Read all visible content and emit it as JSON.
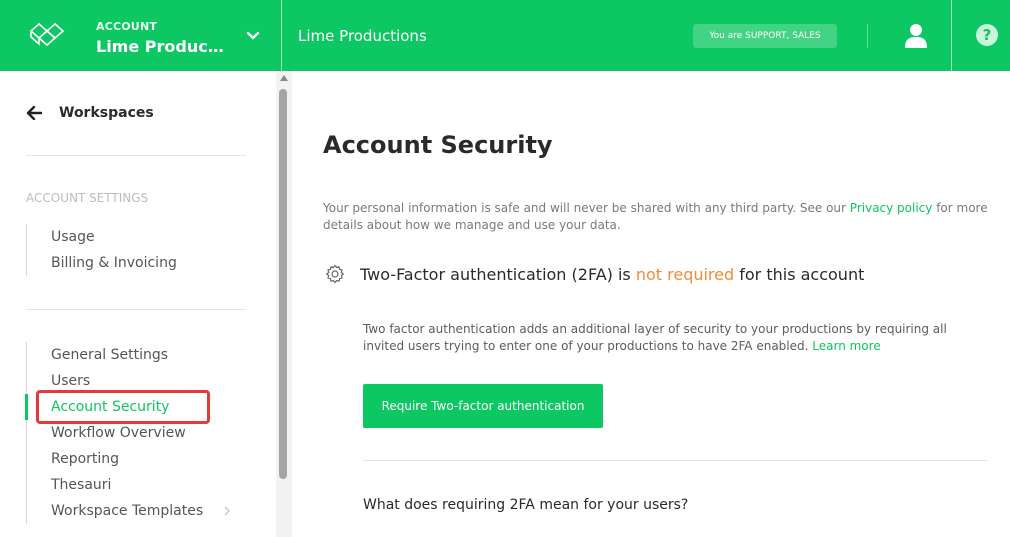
{
  "topbar": {
    "account_label": "ACCOUNT",
    "account_name": "Lime Productions",
    "production_title": "Lime Productions",
    "role_badge": "You are SUPPORT, SALES",
    "help_glyph": "?",
    "brand_color": "#0dc762"
  },
  "sidebar": {
    "back_label": "Workspaces",
    "section_heading": "ACCOUNT SETTINGS",
    "group1": [
      {
        "label": "Usage"
      },
      {
        "label": "Billing & Invoicing"
      }
    ],
    "group2": [
      {
        "label": "General Settings"
      },
      {
        "label": "Users"
      },
      {
        "label": "Account Security",
        "active": true
      },
      {
        "label": "Workflow Overview"
      },
      {
        "label": "Reporting"
      },
      {
        "label": "Thesauri"
      },
      {
        "label": "Workspace Templates"
      }
    ]
  },
  "main": {
    "title": "Account Security",
    "intro_before": "Your personal information is safe and will never be shared with any third party. See our ",
    "intro_link": "Privacy policy",
    "intro_after": " for more details about how we manage and use your data.",
    "twofa_before": "Two-Factor authentication (2FA) is ",
    "twofa_status": "not required",
    "twofa_after": " for this account",
    "twofa_desc": "Two factor authentication adds an additional layer of security to your productions by requiring all invited users trying to enter one of your productions to have 2FA enabled. ",
    "learn_more": "Learn more",
    "cta_label": "Require Two-factor authentication",
    "question": "What does requiring 2FA mean for your users?",
    "warn_color": "#f28b3a"
  },
  "icons": [
    "logo-icon",
    "chevron-down-icon",
    "user-icon",
    "help-icon",
    "arrow-left-icon",
    "gear-icon",
    "caret-right-icon"
  ]
}
